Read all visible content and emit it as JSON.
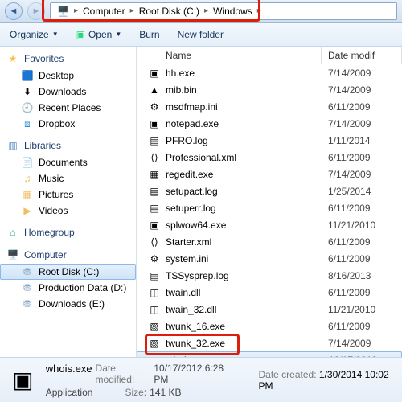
{
  "breadcrumb": [
    "Computer",
    "Root Disk (C:)",
    "Windows"
  ],
  "toolbar": {
    "organize": "Organize",
    "open": "Open",
    "burn": "Burn",
    "newfolder": "New folder"
  },
  "sidebar": {
    "favorites": "Favorites",
    "fav_items": [
      "Desktop",
      "Downloads",
      "Recent Places",
      "Dropbox"
    ],
    "libraries": "Libraries",
    "lib_items": [
      "Documents",
      "Music",
      "Pictures",
      "Videos"
    ],
    "homegroup": "Homegroup",
    "computer": "Computer",
    "drives": [
      "Root Disk (C:)",
      "Production Data (D:)",
      "Downloads (E:)"
    ]
  },
  "columns": {
    "name": "Name",
    "date": "Date modif"
  },
  "files": [
    {
      "name": "hh.exe",
      "date": "7/14/2009",
      "icon": "exe"
    },
    {
      "name": "mib.bin",
      "date": "7/14/2009",
      "icon": "vlc"
    },
    {
      "name": "msdfmap.ini",
      "date": "6/11/2009",
      "icon": "ini"
    },
    {
      "name": "notepad.exe",
      "date": "7/14/2009",
      "icon": "exe"
    },
    {
      "name": "PFRO.log",
      "date": "1/11/2014",
      "icon": "log"
    },
    {
      "name": "Professional.xml",
      "date": "6/11/2009",
      "icon": "xml"
    },
    {
      "name": "regedit.exe",
      "date": "7/14/2009",
      "icon": "reg"
    },
    {
      "name": "setupact.log",
      "date": "1/25/2014",
      "icon": "log"
    },
    {
      "name": "setuperr.log",
      "date": "6/11/2009",
      "icon": "log"
    },
    {
      "name": "splwow64.exe",
      "date": "11/21/2010",
      "icon": "exe"
    },
    {
      "name": "Starter.xml",
      "date": "6/11/2009",
      "icon": "xml"
    },
    {
      "name": "system.ini",
      "date": "6/11/2009",
      "icon": "ini"
    },
    {
      "name": "TSSysprep.log",
      "date": "8/16/2013",
      "icon": "log"
    },
    {
      "name": "twain.dll",
      "date": "6/11/2009",
      "icon": "dll"
    },
    {
      "name": "twain_32.dll",
      "date": "11/21/2010",
      "icon": "dll"
    },
    {
      "name": "twunk_16.exe",
      "date": "6/11/2009",
      "icon": "exe2"
    },
    {
      "name": "twunk_32.exe",
      "date": "7/14/2009",
      "icon": "exe2"
    },
    {
      "name": "whois.exe",
      "date": "10/17/2012",
      "icon": "exe",
      "sel": true
    }
  ],
  "details": {
    "name": "whois.exe",
    "type": "Application",
    "modified_lbl": "Date modified:",
    "modified": "10/17/2012 6:28 PM",
    "size_lbl": "Size:",
    "size": "141 KB",
    "created_lbl": "Date created:",
    "created": "1/30/2014 10:02 PM"
  }
}
